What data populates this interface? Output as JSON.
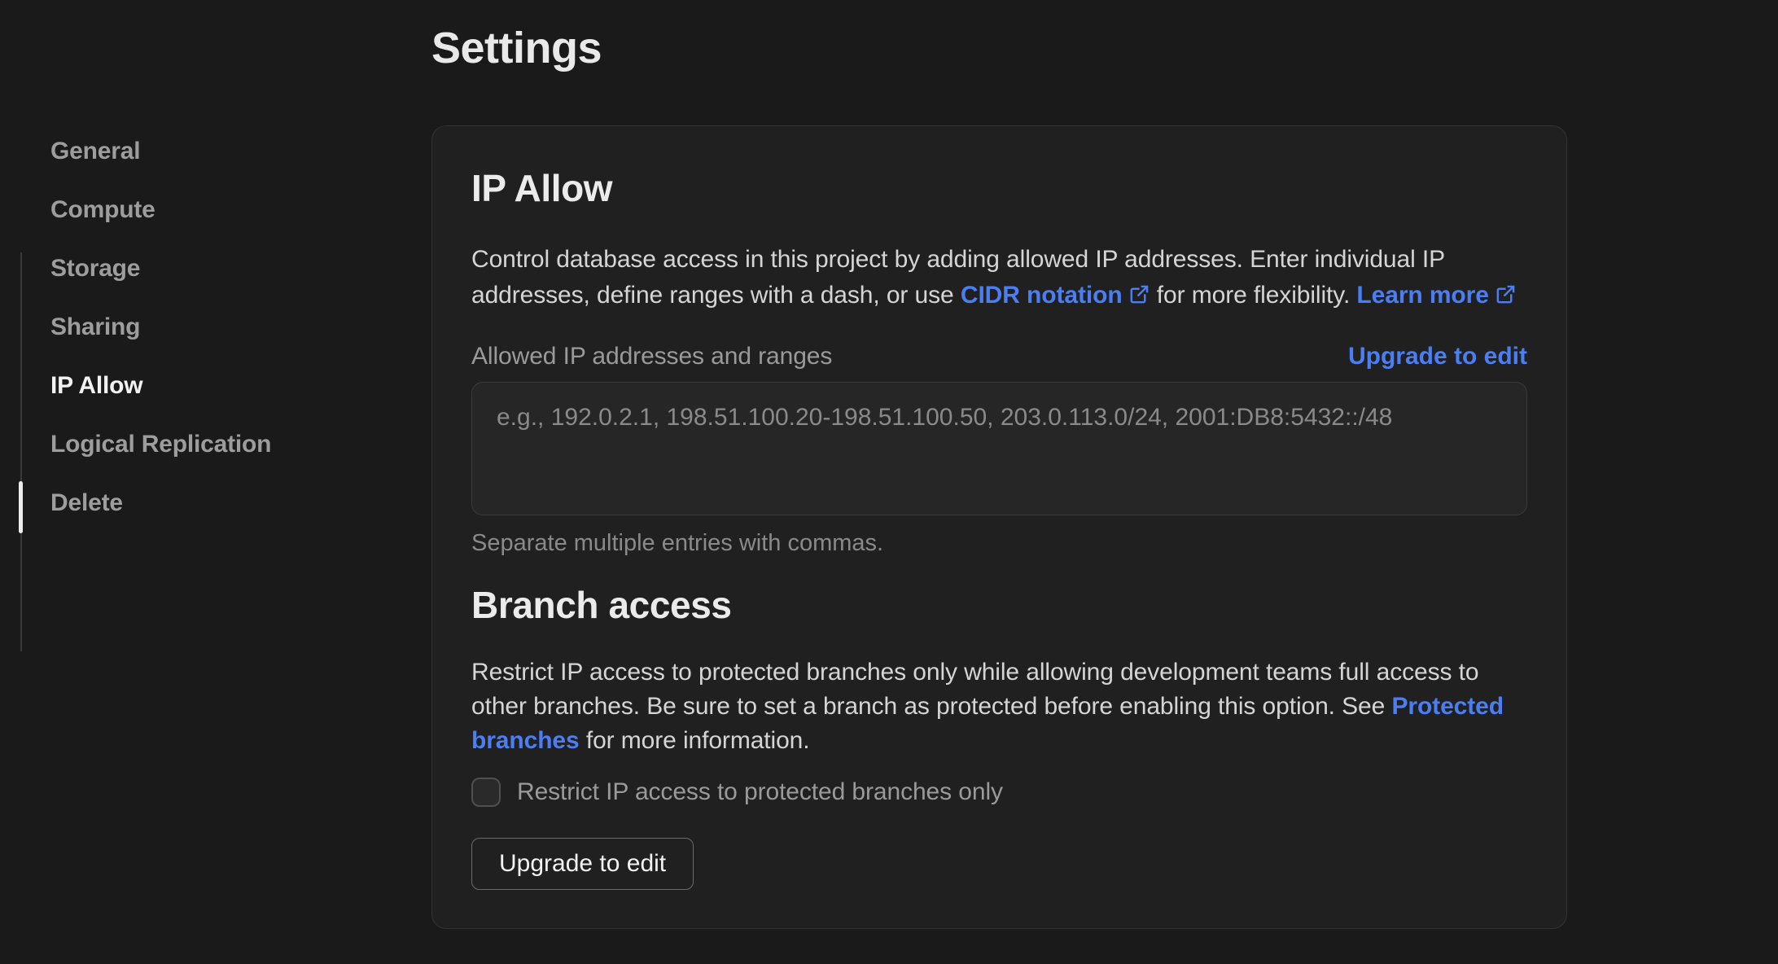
{
  "page": {
    "title": "Settings"
  },
  "colors": {
    "page_background": "#1a1a1a",
    "card_background": "#202020",
    "link_blue": "#4c7ef3",
    "active_indicator": "#ececec"
  },
  "sidebar": {
    "items": [
      {
        "label": "General",
        "active": false
      },
      {
        "label": "Compute",
        "active": false
      },
      {
        "label": "Storage",
        "active": false
      },
      {
        "label": "Sharing",
        "active": false
      },
      {
        "label": "IP Allow",
        "active": true
      },
      {
        "label": "Logical Replication",
        "active": false
      },
      {
        "label": "Delete",
        "active": false
      }
    ]
  },
  "ip_allow": {
    "heading": "IP Allow",
    "desc_part1": "Control database access in this project by adding allowed IP addresses. Enter individual IP addresses, define ranges with a dash, or use ",
    "cidr_link_label": "CIDR notation",
    "desc_part2": " for more flexibility. ",
    "learn_more_label": "Learn more",
    "field_label": "Allowed IP addresses and ranges",
    "upgrade_link_label": "Upgrade to edit",
    "textarea_placeholder": "e.g., 192.0.2.1, 198.51.100.20-198.51.100.50, 203.0.113.0/24, 2001:DB8:5432::/48",
    "textarea_value": "",
    "help_text": "Separate multiple entries with commas."
  },
  "branch_access": {
    "heading": "Branch access",
    "desc_part1": "Restrict IP access to protected branches only while allowing development teams full access to other branches. Be sure to set a branch as protected before enabling this option. See ",
    "protected_link_label": "Protected branches",
    "desc_part2": " for more information.",
    "checkbox_label": "Restrict IP access to protected branches only",
    "checkbox_checked": false,
    "button_label": "Upgrade to edit"
  }
}
